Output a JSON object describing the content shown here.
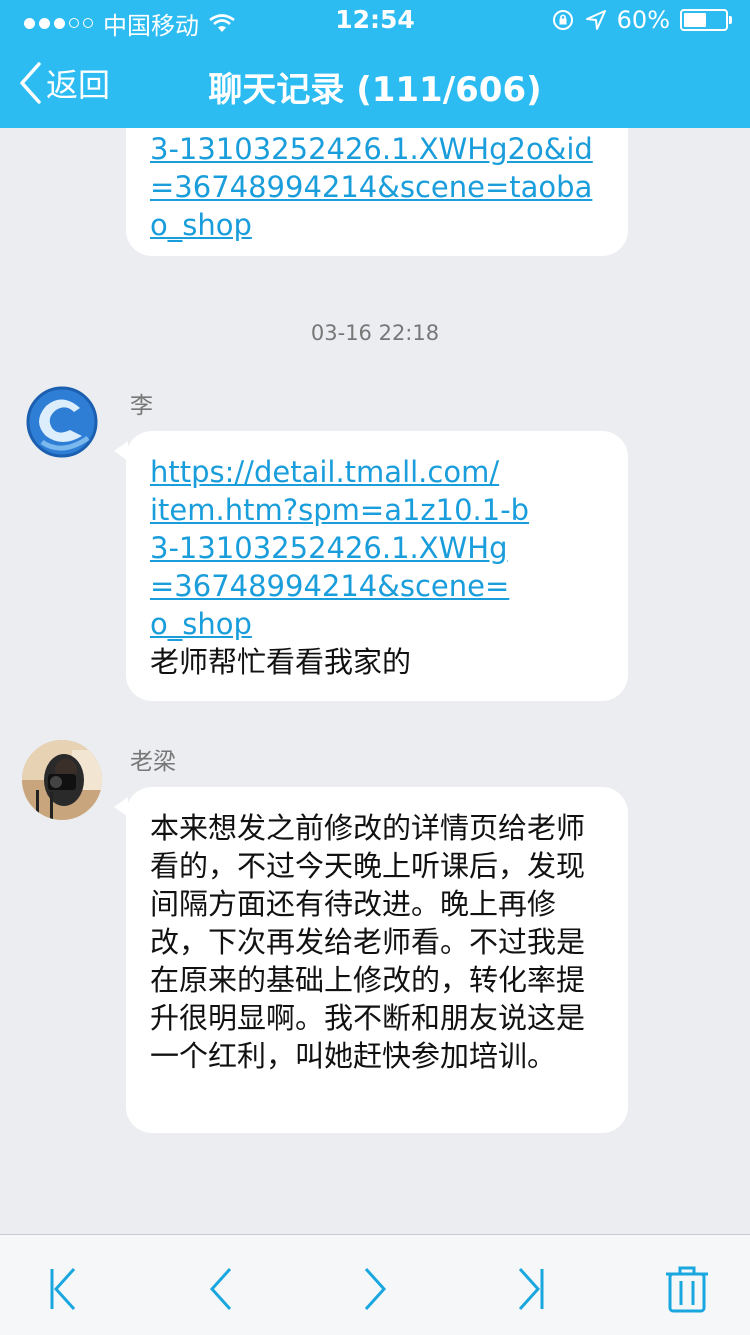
{
  "status_bar": {
    "carrier": "中国移动",
    "time": "12:54",
    "battery_text": "60%",
    "battery_level": 0.6
  },
  "nav": {
    "back_label": "返回",
    "title": "聊天记录 (111/606)"
  },
  "messages": {
    "first": {
      "lines": [
        "3-13103252426.1.XWHg2o&id",
        "=36748994214&scene=taoba",
        "o_shop"
      ]
    },
    "timestamp": "03-16 22:18",
    "second": {
      "sender": "李",
      "link_lines": [
        "https://detail.tmall.com/",
        "item.htm?spm=a1z10.1-b",
        "3-13103252426.1.XWHg",
        "=36748994214&scene=",
        "o_shop"
      ],
      "text": "老师帮忙看看我家的"
    },
    "third": {
      "sender": "老梁",
      "text": "本来想发之前修改的详情页给老师看的，不过今天晚上听课后，发现间隔方面还有待改进。晚上再修改，下次再发给老师看。不过我是在原来的基础上修改的，转化率提升很明显啊。我不断和朋友说这是一个红利，叫她赶快参加培训。"
    }
  },
  "colors": {
    "header": "#2DBCF2",
    "link": "#1A9DDB",
    "background": "#EBEDF0",
    "toolbar_icon": "#1AA7E0"
  },
  "toolbar": {
    "icons": [
      "first-page-icon",
      "previous-icon",
      "next-icon",
      "last-page-icon",
      "trash-icon"
    ]
  }
}
